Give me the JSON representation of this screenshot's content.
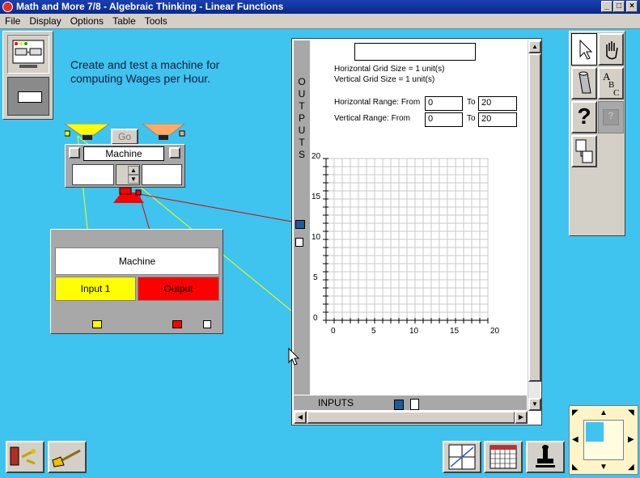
{
  "window": {
    "title": "Math and More 7/8 - Algebraic Thinking - Linear Functions"
  },
  "menu": [
    "File",
    "Display",
    "Options",
    "Table",
    "Tools"
  ],
  "instructions": {
    "line1": "Create and test a machine for",
    "line2": "computing Wages per Hour."
  },
  "machine": {
    "go_label": "Go",
    "name": "Machine"
  },
  "table": {
    "header": "Machine",
    "input_label": "Input 1",
    "output_label": "Output"
  },
  "graph": {
    "outputs_label": "OUTPUTS",
    "inputs_label": "INPUTS",
    "h_grid": "Horizontal Grid Size = 1 unit(s)",
    "v_grid": "Vertical Grid Size = 1 unit(s)",
    "h_range_label": "Horizontal Range: From",
    "v_range_label": "Vertical Range: From",
    "to_label": "To",
    "h_from": "0",
    "h_to": "20",
    "v_from": "0",
    "v_to": "20",
    "x_ticks": [
      "0",
      "5",
      "10",
      "15",
      "20"
    ],
    "y_ticks": [
      "20",
      "15",
      "10",
      "5",
      "0"
    ]
  },
  "colors": {
    "desktop": "#3ec4ee",
    "input_yellow": "#ffff00",
    "output_red": "#ff0000",
    "wire_yellow": "#ffff00",
    "wire_red": "#e00000"
  },
  "icons": {
    "palette": [
      "arrow-pointer-icon",
      "hand-icon",
      "paper-roll-icon",
      "abc-text-icon",
      "help-question-icon",
      "disabled-help-icon",
      "copy-arrow-icon"
    ],
    "bottom_left": [
      "exit-door-icon",
      "broom-icon"
    ],
    "bottom_right": [
      "graph-icon",
      "table-calendar-icon",
      "stamp-icon"
    ]
  }
}
